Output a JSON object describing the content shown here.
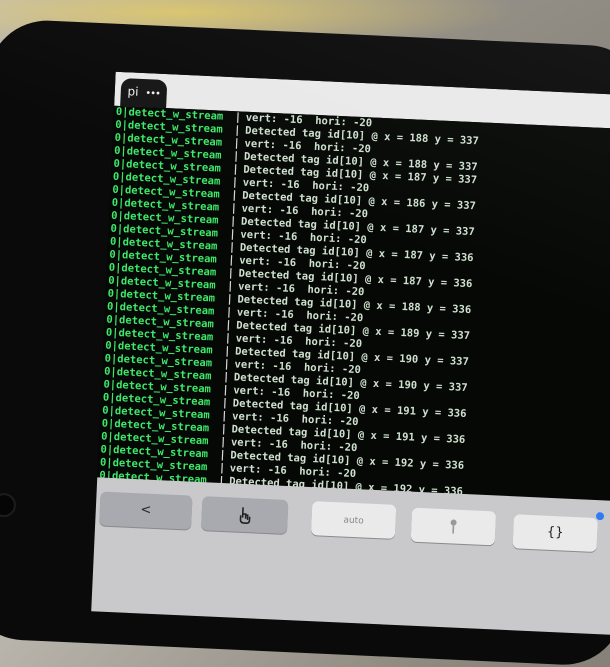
{
  "tab": {
    "label": "pi",
    "menu_icon": "•••"
  },
  "terminal": {
    "rows": [
      {
        "left": "0|detect_w_stream",
        "sep": "|",
        "right": "vert: -16  hori: -20"
      },
      {
        "left": "0|detect_w_stream",
        "sep": "|",
        "right": "Detected tag id[10] @ x = 188 y = 337"
      },
      {
        "left": "0|detect_w_stream",
        "sep": "|",
        "right": "vert: -16  hori: -20"
      },
      {
        "left": "0|detect_w_stream",
        "sep": "|",
        "right": "Detected tag id[10] @ x = 188 y = 337"
      },
      {
        "left": "0|detect_w_stream",
        "sep": "|",
        "right": "Detected tag id[10] @ x = 187 y = 337"
      },
      {
        "left": "0|detect_w_stream",
        "sep": "|",
        "right": "vert: -16  hori: -20"
      },
      {
        "left": "0|detect_w_stream",
        "sep": "|",
        "right": "Detected tag id[10] @ x = 186 y = 337"
      },
      {
        "left": "0|detect_w_stream",
        "sep": "|",
        "right": "vert: -16  hori: -20"
      },
      {
        "left": "0|detect_w_stream",
        "sep": "|",
        "right": "Detected tag id[10] @ x = 187 y = 337"
      },
      {
        "left": "0|detect_w_stream",
        "sep": "|",
        "right": "vert: -16  hori: -20"
      },
      {
        "left": "0|detect_w_stream",
        "sep": "|",
        "right": "Detected tag id[10] @ x = 187 y = 336"
      },
      {
        "left": "0|detect_w_stream",
        "sep": "|",
        "right": "vert: -16  hori: -20"
      },
      {
        "left": "0|detect_w_stream",
        "sep": "|",
        "right": "Detected tag id[10] @ x = 187 y = 336"
      },
      {
        "left": "0|detect_w_stream",
        "sep": "|",
        "right": "vert: -16  hori: -20"
      },
      {
        "left": "0|detect_w_stream",
        "sep": "|",
        "right": "Detected tag id[10] @ x = 188 y = 336"
      },
      {
        "left": "0|detect_w_stream",
        "sep": "|",
        "right": "vert: -16  hori: -20"
      },
      {
        "left": "0|detect_w_stream",
        "sep": "|",
        "right": "Detected tag id[10] @ x = 189 y = 337"
      },
      {
        "left": "0|detect_w_stream",
        "sep": "|",
        "right": "vert: -16  hori: -20"
      },
      {
        "left": "0|detect_w_stream",
        "sep": "|",
        "right": "Detected tag id[10] @ x = 190 y = 337"
      },
      {
        "left": "0|detect_w_stream",
        "sep": "|",
        "right": "vert: -16  hori: -20"
      },
      {
        "left": "0|detect_w_stream",
        "sep": "|",
        "right": "Detected tag id[10] @ x = 190 y = 337"
      },
      {
        "left": "0|detect_w_stream",
        "sep": "|",
        "right": "vert: -16  hori: -20"
      },
      {
        "left": "0|detect_w_stream",
        "sep": "|",
        "right": "Detected tag id[10] @ x = 191 y = 336"
      },
      {
        "left": "0|detect_w_stream",
        "sep": "|",
        "right": "vert: -16  hori: -20"
      },
      {
        "left": "0|detect_w_stream",
        "sep": "|",
        "right": "Detected tag id[10] @ x = 191 y = 336"
      },
      {
        "left": "0|detect_w_stream",
        "sep": "|",
        "right": "vert: -16  hori: -20"
      },
      {
        "left": "0|detect_w_stream",
        "sep": "|",
        "right": "Detected tag id[10] @ x = 192 y = 336"
      },
      {
        "left": "0|detect_w_stream",
        "sep": "|",
        "right": "vert: -16  hori: -20"
      },
      {
        "left": "0|detect_w_stream",
        "sep": "|",
        "right": "Detected tag id[10] @ x = 192 y = 336"
      }
    ]
  },
  "keyboard": {
    "back_key": "<",
    "gesture_icon": "hand-tap-icon",
    "input_hint": "auto",
    "pin_icon": "pin-icon",
    "brace_key": "{}"
  },
  "colors": {
    "terminal_green": "#3fe86a",
    "terminal_bg": "#050805",
    "tab_bg": "#161616"
  }
}
